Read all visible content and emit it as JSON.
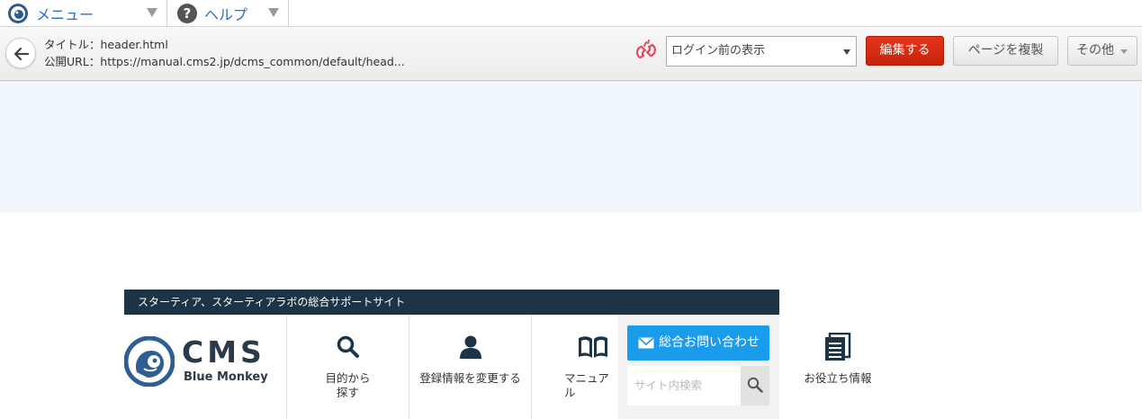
{
  "menubar": {
    "menu_label": "メニュー",
    "help_label": "ヘルプ",
    "help_glyph": "?",
    "accent": "#2c6fbf"
  },
  "toolbar": {
    "title_line": "タイトル：header.html",
    "url_line": "公開URL：https://manual.cms2.jp/dcms_common/default/head...",
    "view_select_value": "ログイン前の表示",
    "edit_label": "編集する",
    "edit_color": "#d42c10",
    "copy_label": "ページを複製",
    "other_label": "その他"
  },
  "site": {
    "tagline": "スターティア、スターティアラボの総合サポートサイト",
    "logo_word": "CMS",
    "logo_sub": "Blue Monkey",
    "nav": [
      {
        "label": "目的から\n探す",
        "icon": "search-icon"
      },
      {
        "label": "登録情報を変更する",
        "icon": "user-icon"
      },
      {
        "label": "マニュアル",
        "icon": "book-icon"
      },
      {
        "label": "お役立ち情報",
        "icon": "document-icon"
      }
    ],
    "contact_label": "総合お問い合わせ",
    "search_placeholder": "サイト内検索",
    "brand_dark": "#1c3546",
    "contact_color": "#1b9bec"
  }
}
